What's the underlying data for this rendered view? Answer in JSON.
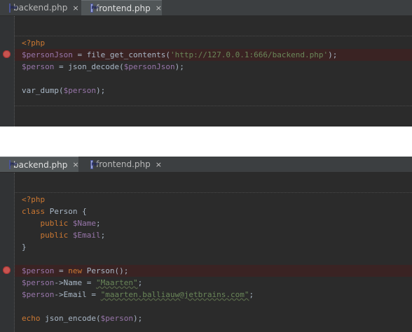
{
  "panels": [
    {
      "tabs": [
        {
          "label": "backend.php",
          "close": "×"
        },
        {
          "label": "frontend.php",
          "close": "×"
        }
      ],
      "code": {
        "l1": "<?php",
        "l2_var": "$personJson",
        "l2_op": " = ",
        "l2_fn": "file_get_contents(",
        "l2_str": "'http://127.0.0.1:666/backend.php'",
        "l2_end": ");",
        "l3_var": "$person",
        "l3_op": " = ",
        "l3_fn": "json_decode(",
        "l3_arg": "$personJson",
        "l3_end": ");",
        "l5_fn": "var_dump(",
        "l5_arg": "$person",
        "l5_end": ");"
      }
    },
    {
      "tabs": [
        {
          "label": "backend.php",
          "close": "×"
        },
        {
          "label": "frontend.php",
          "close": "×"
        }
      ],
      "code": {
        "l1": "<?php",
        "l2_kw": "class",
        "l2_rest": " Person {",
        "l3_kw": "    public",
        "l3_var": " $Name",
        "l3_end": ";",
        "l4_kw": "    public",
        "l4_var": " $Email",
        "l4_end": ";",
        "l5": "}",
        "l7_var": "$person",
        "l7_op": " = ",
        "l7_kw": "new",
        "l7_rest": " Person();",
        "l8_var": "$person",
        "l8_rest": "->Name = ",
        "l8_str": "\"Maarten\"",
        "l8_end": ";",
        "l9_var": "$person",
        "l9_rest": "->Email = ",
        "l9_str": "\"maarten.balliauw@jetbrains.com\"",
        "l9_end": ";",
        "l11_kw": "echo",
        "l11_fn": " json_encode(",
        "l11_arg": "$person",
        "l11_end": ");"
      }
    }
  ],
  "colors": {
    "editor_bg": "#2b2b2b",
    "keyword": "#cc7832",
    "variable": "#9876aa",
    "string": "#6a8759",
    "breakpoint": "#c75450"
  }
}
